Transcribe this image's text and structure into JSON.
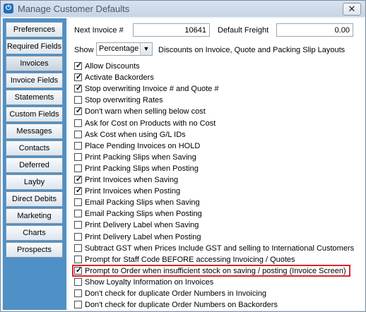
{
  "window": {
    "title": "Manage Customer Defaults",
    "close_glyph": "✕",
    "icon": "app-power-icon"
  },
  "sidebar": {
    "items": [
      {
        "label": "Preferences"
      },
      {
        "label": "Required Fields"
      },
      {
        "label": "Invoices"
      },
      {
        "label": "Invoice Fields"
      },
      {
        "label": "Statements"
      },
      {
        "label": "Custom Fields"
      },
      {
        "label": "Messages"
      },
      {
        "label": "Contacts"
      },
      {
        "label": "Deferred"
      },
      {
        "label": "Layby"
      },
      {
        "label": "Direct Debits"
      },
      {
        "label": "Marketing"
      },
      {
        "label": "Charts"
      },
      {
        "label": "Prospects"
      }
    ],
    "active": "Invoices"
  },
  "main": {
    "next_invoice_label": "Next Invoice #",
    "next_invoice_value": "10641",
    "default_freight_label": "Default Freight",
    "default_freight_value": "0.00",
    "show_label": "Show",
    "show_select_value": "Percentage",
    "show_suffix": "Discounts on Invoice, Quote and Packing Slip Layouts",
    "options": [
      {
        "label": "Allow Discounts",
        "checked": true
      },
      {
        "label": "Activate Backorders",
        "checked": true
      },
      {
        "label": "Stop overwriting Invoice # and Quote #",
        "checked": true
      },
      {
        "label": "Stop overwriting Rates",
        "checked": false
      },
      {
        "label": "Don't warn when selling below cost",
        "checked": true
      },
      {
        "label": "Ask for Cost on Products with no Cost",
        "checked": false
      },
      {
        "label": "Ask Cost when using G/L IDs",
        "checked": false
      },
      {
        "label": "Place Pending Invoices on HOLD",
        "checked": false
      },
      {
        "label": "Print Packing Slips when Saving",
        "checked": false
      },
      {
        "label": "Print Packing Slips when Posting",
        "checked": false
      },
      {
        "label": "Print Invoices when Saving",
        "checked": true
      },
      {
        "label": "Print Invoices when Posting",
        "checked": true
      },
      {
        "label": "Email Packing Slips when Saving",
        "checked": false
      },
      {
        "label": "Email Packing Slips when Posting",
        "checked": false
      },
      {
        "label": "Print Delivery Label when Saving",
        "checked": false
      },
      {
        "label": "Print Delivery Label when Posting",
        "checked": false
      },
      {
        "label": "Subtract GST when Prices Include GST and selling to International Customers",
        "checked": false
      },
      {
        "label": "Prompt for Staff Code BEFORE accessing Invoicing / Quotes",
        "checked": false
      },
      {
        "label": "Prompt to Order when insufficient stock on saving / posting (Invoice Screen)",
        "checked": true
      },
      {
        "label": "Show Loyalty Information on Invoices",
        "checked": false
      },
      {
        "label": "Don't check for duplicate Order Numbers in Invoicing",
        "checked": false
      },
      {
        "label": "Don't check for duplicate Order Numbers on Backorders",
        "checked": false
      }
    ],
    "highlighted_index": 18,
    "highlight_color": "#d9262e"
  }
}
